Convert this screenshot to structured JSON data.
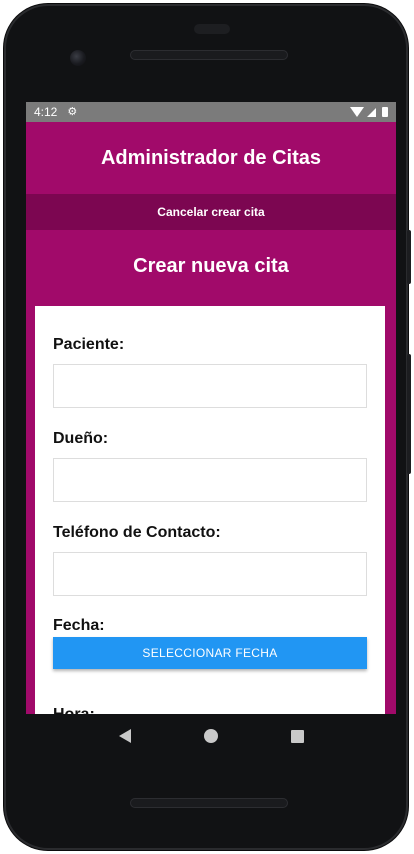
{
  "status_bar": {
    "time": "4:12",
    "icons": [
      "gear-icon",
      "wifi-icon",
      "signal-icon",
      "battery-icon"
    ]
  },
  "app": {
    "title": "Administrador de Citas",
    "cancel_label": "Cancelar crear cita",
    "section_title": "Crear nueva cita"
  },
  "form": {
    "paciente_label": "Paciente:",
    "paciente_value": "",
    "dueno_label": "Dueño:",
    "dueno_value": "",
    "telefono_label": "Teléfono de Contacto:",
    "telefono_value": "",
    "fecha_label": "Fecha:",
    "fecha_button": "SELECCIONAR FECHA",
    "hora_label": "Hora:"
  },
  "nav": [
    "back-icon",
    "home-icon",
    "recents-icon"
  ],
  "colors": {
    "primary": "#a10a6a",
    "primary_dark": "#7c0651",
    "button_blue": "#2196f3",
    "status_bar": "#7b7b7b"
  }
}
